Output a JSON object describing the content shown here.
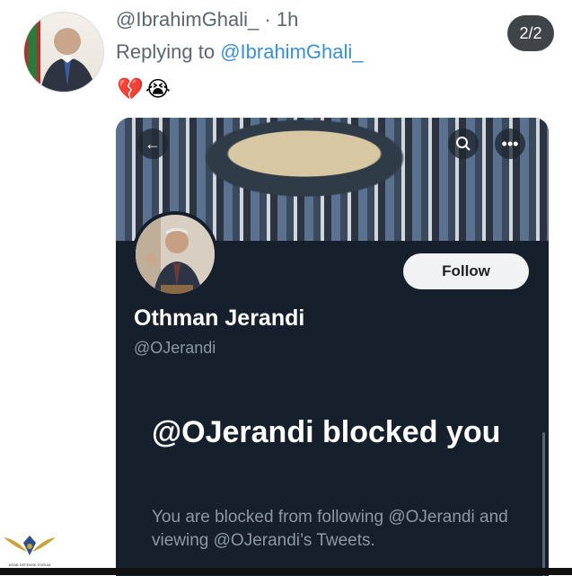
{
  "tweet": {
    "author_handle": "@IbrahimGhali_",
    "time": "· 1h",
    "replying_prefix": "Replying to",
    "replying_to": "@IbrahimGhali_",
    "emojis": "💔😭"
  },
  "page_indicator": "2/2",
  "profile": {
    "display_name": "Othman Jerandi",
    "handle": "@OJerandi",
    "follow_label": "Follow",
    "blocked_title": "@OJerandi blocked you",
    "blocked_description": "You are blocked from following @OJerandi and viewing @OJerandi’s Tweets."
  },
  "banner_icons": {
    "back": "arrow-left-icon",
    "search": "search-icon",
    "more": "more-icon"
  },
  "watermark": {
    "text": "ARAB DEFENSE FORUM"
  },
  "colors": {
    "profile_bg": "#16202c",
    "link_blue": "#3a8fd6",
    "muted_gray": "#8b98a5",
    "follow_bg": "#f0f2f4"
  }
}
